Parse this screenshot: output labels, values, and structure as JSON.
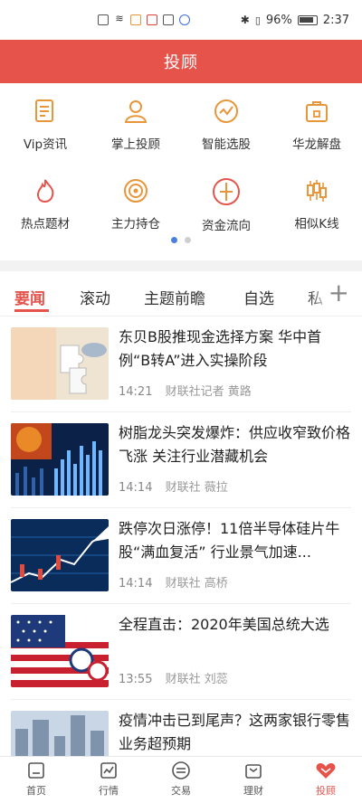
{
  "status_bar": {
    "battery": "96%",
    "time": "2:37"
  },
  "header": {
    "title": "投顾"
  },
  "feature_grid": [
    {
      "label": "Vip资讯",
      "icon": "document-icon"
    },
    {
      "label": "掌上投顾",
      "icon": "person-icon"
    },
    {
      "label": "智能选股",
      "icon": "trend-circle-icon"
    },
    {
      "label": "华龙解盘",
      "icon": "briefcase-lock-icon"
    },
    {
      "label": "热点题材",
      "icon": "flame-icon"
    },
    {
      "label": "主力持仓",
      "icon": "target-icon"
    },
    {
      "label": "资金流向",
      "icon": "compass-icon"
    },
    {
      "label": "相似K线",
      "icon": "candlestick-icon"
    }
  ],
  "pager": {
    "pages": 2,
    "active": 1
  },
  "tabs": [
    "要闻",
    "滚动",
    "主题前瞻",
    "自选",
    "私"
  ],
  "news": [
    {
      "title": "东贝B股推现金选择方案 华中首例“B转A”进入实操阶段",
      "time": "14:21",
      "source": "财联社记者 黄路"
    },
    {
      "title": "树脂龙头突发爆炸：供应收窄致价格飞涨 关注行业潜藏机会",
      "time": "14:14",
      "source": "财联社 薇拉"
    },
    {
      "title": "跌停次日涨停！11倍半导体硅片牛股“满血复活” 行业景气加速...",
      "time": "14:14",
      "source": "财联社 高桥"
    },
    {
      "title": "全程直击：2020年美国总统大选",
      "time": "13:55",
      "source": "财联社 刘蕊"
    },
    {
      "title": "疫情冲击已到尾声？这两家银行零售业务超预期",
      "time": "",
      "source": ""
    }
  ],
  "bottom_nav": [
    {
      "label": "首页",
      "icon": "home-icon"
    },
    {
      "label": "行情",
      "icon": "chart-icon"
    },
    {
      "label": "交易",
      "icon": "exchange-icon"
    },
    {
      "label": "理财",
      "icon": "wallet-icon"
    },
    {
      "label": "投顾",
      "icon": "advisor-heart-icon"
    }
  ],
  "colors": {
    "accent": "#e5534b",
    "icon_orange": "#e8963a",
    "pager_active": "#4a7fe0"
  }
}
